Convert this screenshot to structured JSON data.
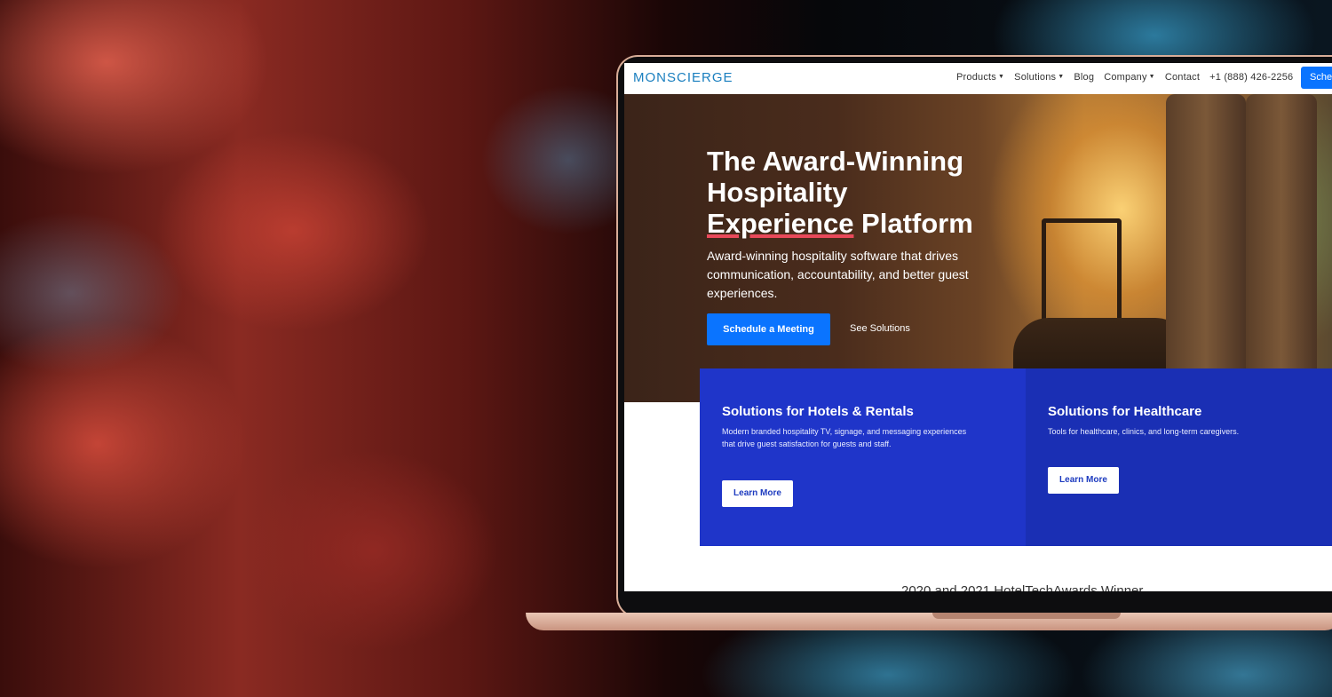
{
  "nav": {
    "logo": "MONSCIERGE",
    "items": [
      {
        "label": "Products",
        "dropdown": true
      },
      {
        "label": "Solutions",
        "dropdown": true
      },
      {
        "label": "Blog",
        "dropdown": false
      },
      {
        "label": "Company",
        "dropdown": true
      },
      {
        "label": "Contact",
        "dropdown": false
      }
    ],
    "phone": "+1 (888) 426-2256",
    "cta_label": "Sche"
  },
  "hero": {
    "title_line1": "The Award-Winning",
    "title_line2": "Hospitality",
    "title_line3_em": "Experience",
    "title_line3_rest": " Platform",
    "subtitle": "Award-winning hospitality software that drives communication, accountability, and better guest experiences.",
    "primary_button": "Schedule a Meeting",
    "secondary_link": "See Solutions"
  },
  "cards": [
    {
      "title": "Solutions for Hotels & Rentals",
      "body": "Modern branded hospitality TV, signage, and messaging experiences that drive guest satisfaction for guests and staff.",
      "button": "Learn More"
    },
    {
      "title": "Solutions for Healthcare",
      "body": "Tools for healthcare, clinics, and long-term caregivers.",
      "button": "Learn More"
    }
  ],
  "awards_heading": "2020 and 2021 HotelTechAwards Winner",
  "colors": {
    "accent": "#0a74ff",
    "card_blue": "#1f35c9",
    "card_blue_dark": "#1a2fb4",
    "underline": "#e9495a",
    "laptop_rose_gold": "#d8ad98"
  }
}
